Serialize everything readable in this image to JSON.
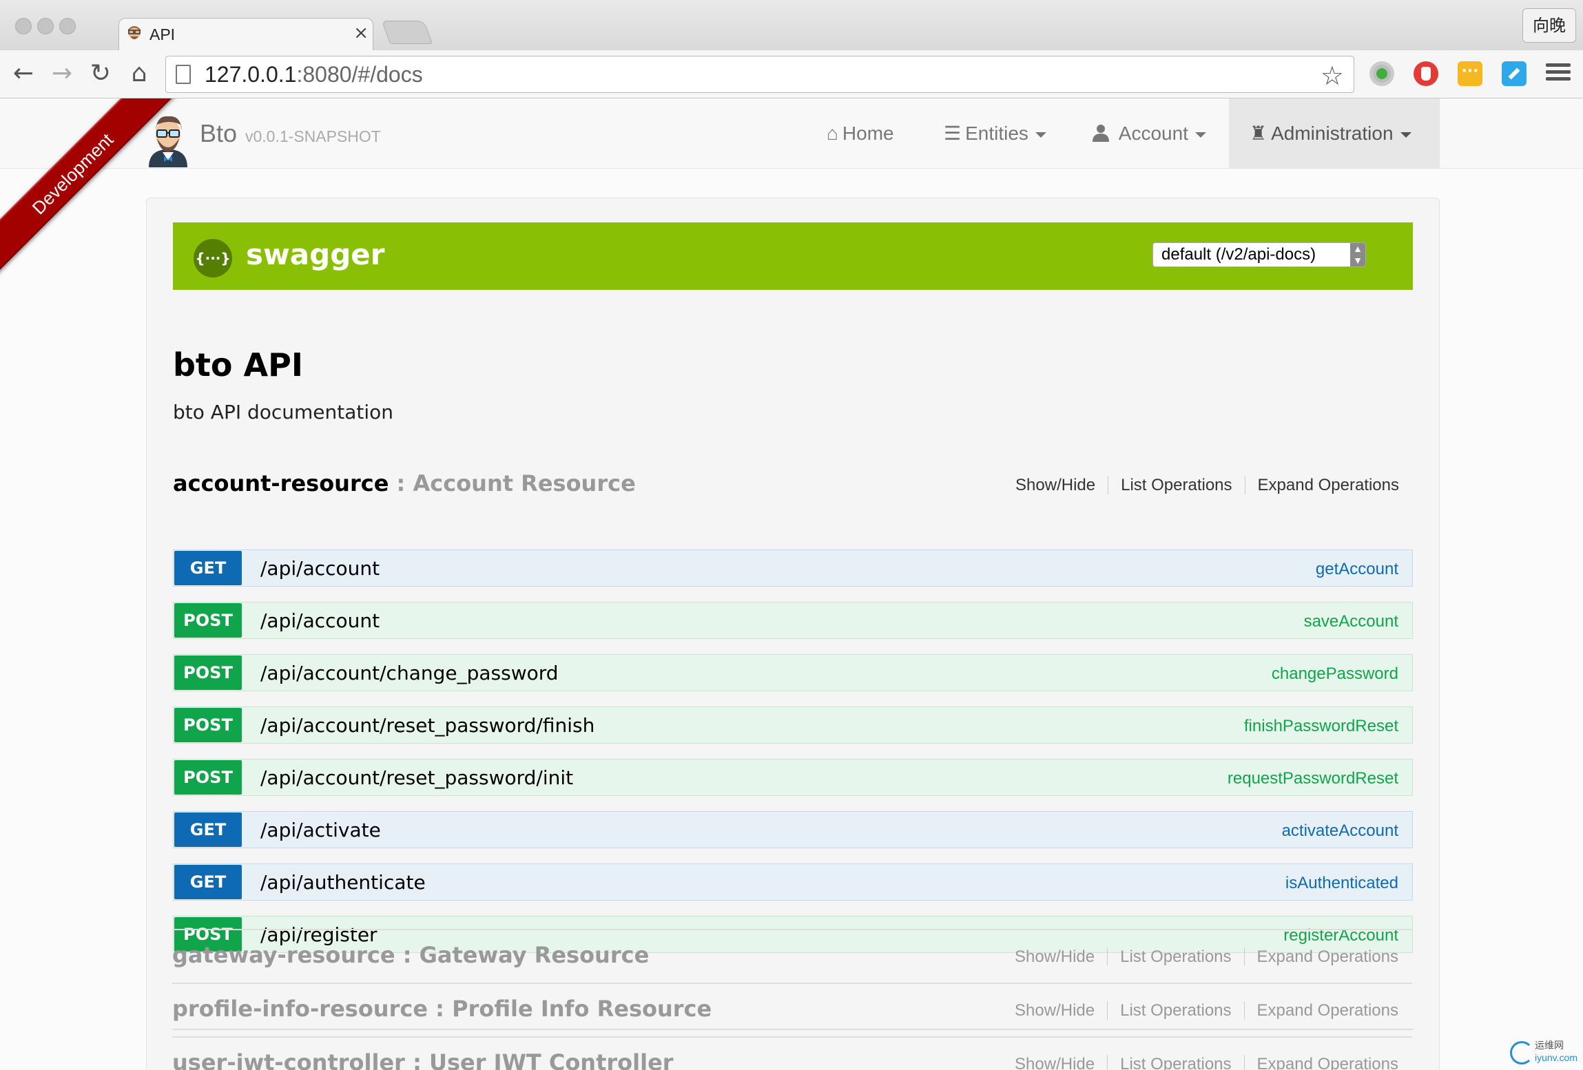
{
  "browser": {
    "tab_title": "API",
    "tab_close": "×",
    "profile_label": "向晚",
    "url_host": "127.0.0.1",
    "url_rest": ":8080/#/docs",
    "back": "←",
    "forward": "→",
    "reload": "↻",
    "home": "⌂",
    "star": "☆"
  },
  "nav": {
    "brand": "Bto",
    "version": "v0.0.1-SNAPSHOT",
    "ribbon": "Development",
    "items": [
      {
        "label": "Home",
        "icon": "home-icon",
        "glyph": "⌂"
      },
      {
        "label": "Entities",
        "icon": "list-icon",
        "glyph": "☰"
      },
      {
        "label": "Account",
        "icon": "user-icon",
        "glyph": "👤"
      },
      {
        "label": "Administration",
        "icon": "tower-icon",
        "glyph": "♜"
      }
    ]
  },
  "swagger": {
    "logo": "{···}",
    "title": "swagger",
    "spec_select": "default (/v2/api-docs)"
  },
  "api": {
    "title": "bto API",
    "description": "bto API documentation"
  },
  "resources": [
    {
      "name": "account-resource",
      "sep": " : ",
      "desc": "Account Resource",
      "links": [
        "Show/Hide",
        "List Operations",
        "Expand Operations"
      ],
      "operations": [
        {
          "method": "GET",
          "path": "/api/account",
          "nickname": "getAccount"
        },
        {
          "method": "POST",
          "path": "/api/account",
          "nickname": "saveAccount"
        },
        {
          "method": "POST",
          "path": "/api/account/change_password",
          "nickname": "changePassword"
        },
        {
          "method": "POST",
          "path": "/api/account/reset_password/finish",
          "nickname": "finishPasswordReset"
        },
        {
          "method": "POST",
          "path": "/api/account/reset_password/init",
          "nickname": "requestPasswordReset"
        },
        {
          "method": "GET",
          "path": "/api/activate",
          "nickname": "activateAccount"
        },
        {
          "method": "GET",
          "path": "/api/authenticate",
          "nickname": "isAuthenticated"
        },
        {
          "method": "POST",
          "path": "/api/register",
          "nickname": "registerAccount"
        }
      ]
    },
    {
      "name": "gateway-resource",
      "sep": " : ",
      "desc": "Gateway Resource",
      "links": [
        "Show/Hide",
        "List Operations",
        "Expand Operations"
      ]
    },
    {
      "name": "profile-info-resource",
      "sep": " : ",
      "desc": "Profile Info Resource",
      "links": [
        "Show/Hide",
        "List Operations",
        "Expand Operations"
      ]
    },
    {
      "name": "user-jwt-controller",
      "sep": " : ",
      "desc": "User JWT Controller",
      "links": [
        "Show/Hide",
        "List Operations",
        "Expand Operations"
      ]
    }
  ],
  "watermark": {
    "line1": "运维网",
    "line2": "iyunv.com"
  },
  "colors": {
    "get": "#0f6ab4",
    "post": "#10a54a",
    "swagger_green": "#89bf04",
    "ribbon": "#a30000"
  }
}
